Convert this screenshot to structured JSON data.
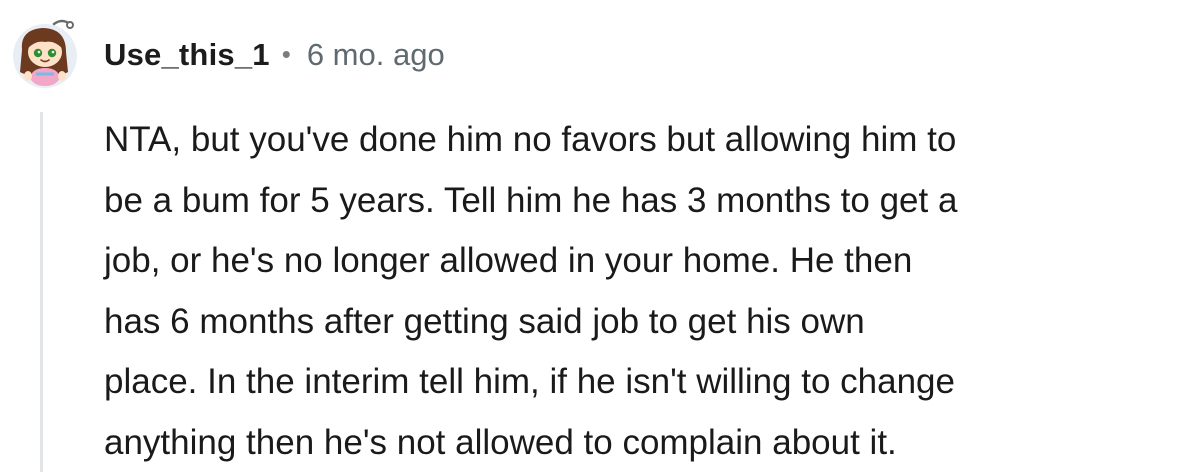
{
  "comment": {
    "author": "Use_this_1",
    "separator": "•",
    "timestamp": "6 mo. ago",
    "avatar_icon": "snoo-avatar-icon",
    "body_lines": [
      "NTA, but you've done him no favors but allowing him to",
      "be a bum for 5 years. Tell him he has 3 months to get a",
      "job, or he's no longer allowed in your home. He then",
      "has 6 months after getting said job to get his own",
      "place. In the interim tell him, if he isn't willing to change",
      "anything then he's not allowed to complain about it."
    ]
  },
  "colors": {
    "text": "#1a1a1b",
    "meta": "#5f6a70",
    "thread_line": "#e3e6e8",
    "avatar_bg": "#e9eef4"
  }
}
